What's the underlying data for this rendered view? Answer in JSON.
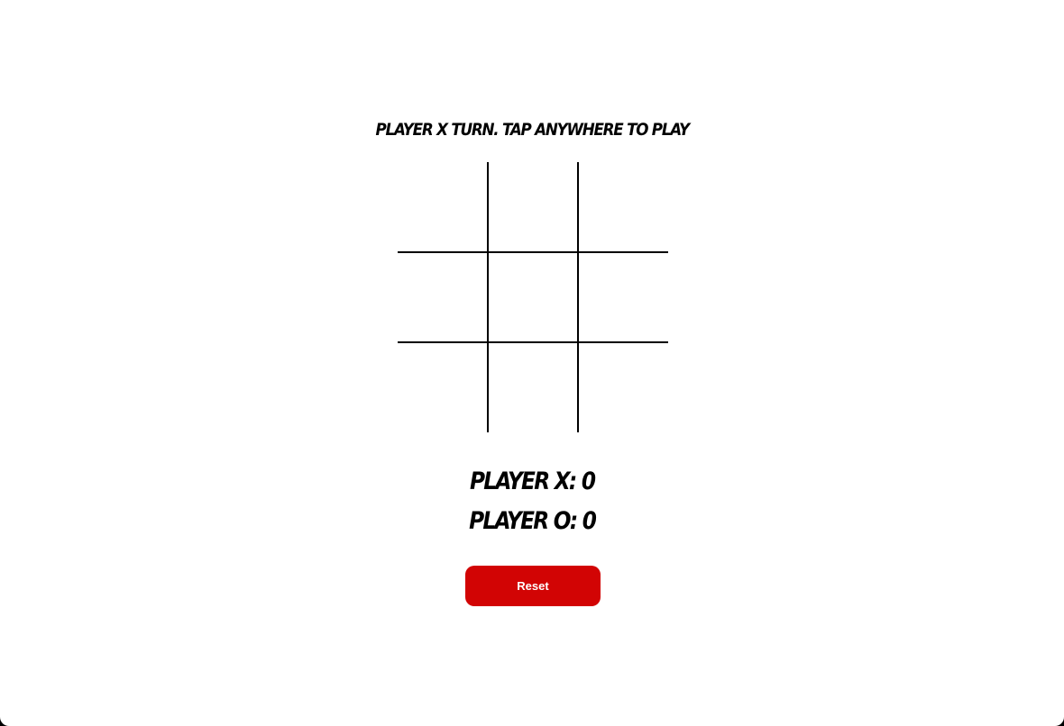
{
  "game": {
    "status_text": "Player X Turn. Tap anywhere to play",
    "board": {
      "cells": [
        "",
        "",
        "",
        "",
        "",
        "",
        "",
        "",
        ""
      ]
    },
    "scores": {
      "player_x": "Player X: 0",
      "player_o": "Player O: 0"
    },
    "reset_label": "Reset"
  },
  "colors": {
    "background": "#ffffff",
    "grid_lines": "#000000",
    "reset_button": "#d20404",
    "reset_text": "#ffffff"
  }
}
